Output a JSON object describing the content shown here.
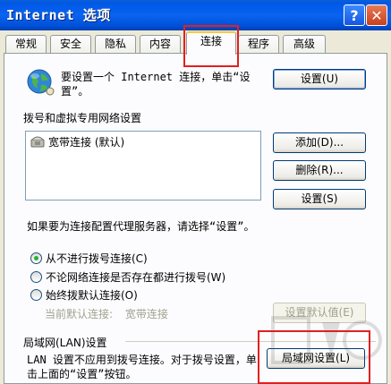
{
  "window": {
    "title": "Internet 选项",
    "help_label": "?",
    "close_label": "✕"
  },
  "tabs": [
    {
      "label": "常规",
      "active": false
    },
    {
      "label": "安全",
      "active": false
    },
    {
      "label": "隐私",
      "active": false
    },
    {
      "label": "内容",
      "active": false
    },
    {
      "label": "连接",
      "active": true
    },
    {
      "label": "程序",
      "active": false
    },
    {
      "label": "高级",
      "active": false
    }
  ],
  "setup": {
    "text": "要设置一个 Internet 连接，单击“设置”。",
    "button_label": "设置(U)"
  },
  "dialup": {
    "section_label": "拨号和虚拟专用网络设置",
    "connections": [
      "宽带连接 (默认)"
    ],
    "add_label": "添加(D)...",
    "remove_label": "删除(R)...",
    "settings_label": "设置(S)",
    "proxy_text": "如果要为连接配置代理服务器，请选择“设置”。",
    "options": [
      {
        "label": "从不进行拨号连接(C)",
        "checked": true
      },
      {
        "label": "不论网络连接是否存在都进行拨号(W)",
        "checked": false
      },
      {
        "label": "始终拨默认连接(O)",
        "checked": false
      }
    ],
    "default_label": "当前默认连接:",
    "default_value": "宽带连接",
    "set_default_label": "设置默认值(E)"
  },
  "lan": {
    "section_label": "局域网(LAN)设置",
    "text": "LAN 设置不应用到拨号连接。对于拨号设置，单击上面的“设置”按钮。",
    "button_label": "局域网设置(L)"
  },
  "icons": {
    "globe": "globe-network-icon",
    "connection": "phone-connection-icon"
  },
  "colors": {
    "titlebar": "#0058e6",
    "active_tab_accent": "#ffc83c",
    "highlight_box": "#e02020"
  }
}
